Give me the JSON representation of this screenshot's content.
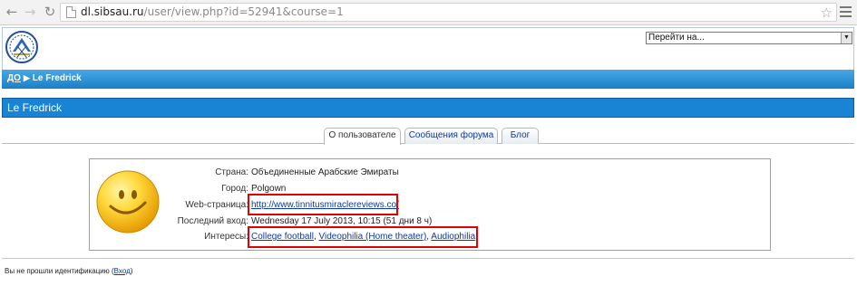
{
  "browser": {
    "url_host": "dl.sibsau.ru",
    "url_path": "/user/view.php?id=52941&course=1"
  },
  "header": {
    "jump_select": "Перейти на...",
    "breadcrumb": {
      "home": "ДО",
      "separator": "▶",
      "current": "Le Fredrick"
    }
  },
  "page": {
    "title": "Le Fredrick"
  },
  "tabs": [
    {
      "label": "О пользователе"
    },
    {
      "label": "Сообщения форума"
    },
    {
      "label": "Блог"
    }
  ],
  "profile": {
    "country_label": "Страна:",
    "country": "Объединенные Арабские Эмираты",
    "city_label": "Город:",
    "city": "Polgown",
    "web_label": "Web-страница:",
    "web": "http://www.tinnitusmiraclereviews.co/",
    "last_access_label": "Последний вход:",
    "last_access": "Wednesday 17 July 2013, 10:15  (51 дни 8 ч)",
    "interests_label": "Интересы:",
    "interests": [
      "College football",
      "Videophilia (Home theater)",
      "Audiophilia"
    ]
  },
  "footer": {
    "login_prefix": "Вы не прошли идентификацию (",
    "login_link": "Вход",
    "login_suffix": ")"
  },
  "colors": {
    "navbar": "#1a84d4",
    "link": "#0b3aa8",
    "highlight": "#e20000"
  }
}
